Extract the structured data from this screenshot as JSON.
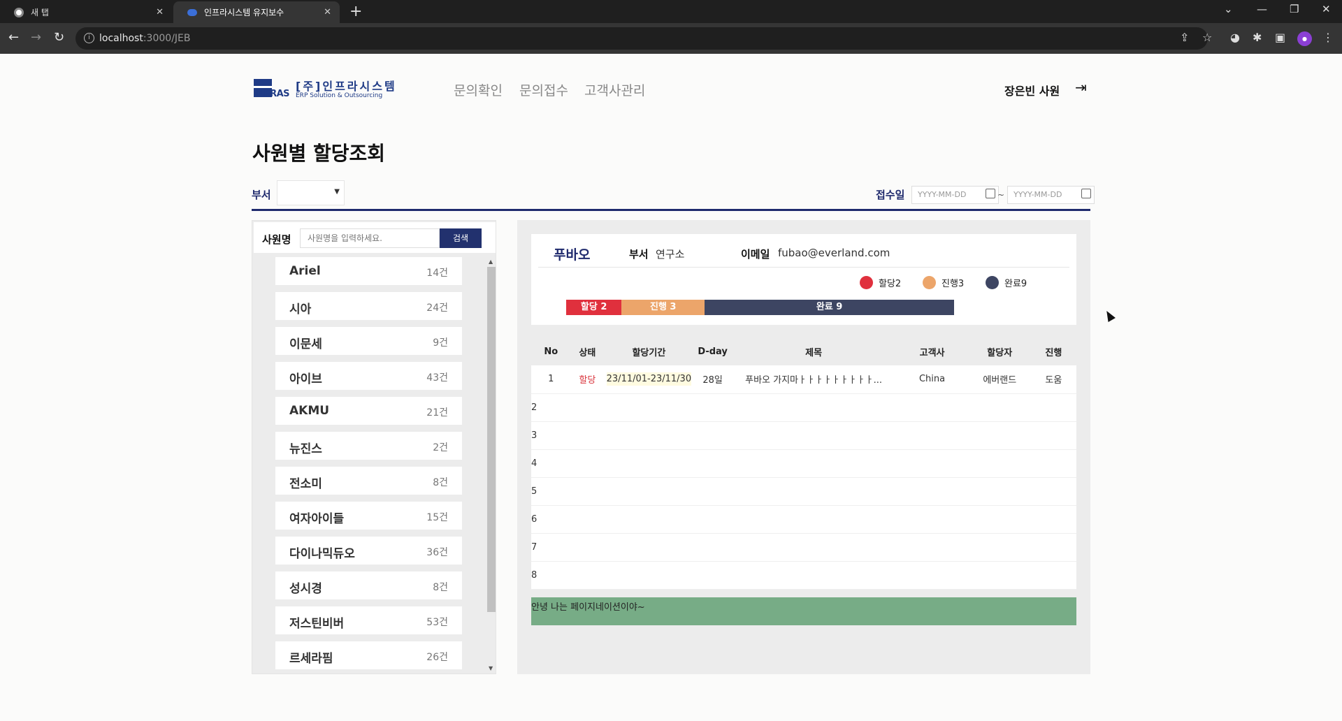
{
  "browser": {
    "tabs": [
      {
        "title": "새 탭",
        "active": false
      },
      {
        "title": "인프라시스템 유지보수",
        "active": true
      }
    ],
    "url_host": "localhost",
    "url_path": ":3000/JEB"
  },
  "header": {
    "logo_brand": "INFRAS",
    "logo_name": "[주]인프라시스템",
    "logo_sub": "ERP Solution & Outsourcing",
    "nav": [
      "문의확인",
      "문의접수",
      "고객사관리"
    ],
    "user": "장은빈 사원"
  },
  "page": {
    "title": "사원별 할당조회"
  },
  "filters": {
    "dept_label": "부서",
    "dept_value": "",
    "date_label": "접수일",
    "date_from_placeholder": "YYYY-MM-DD",
    "date_to_placeholder": "YYYY-MM-DD",
    "separator": "~"
  },
  "employee_search": {
    "label": "사원명",
    "placeholder": "사원명을 입력하세요.",
    "button": "검색"
  },
  "employees": [
    {
      "name": "Ariel",
      "count": "14건"
    },
    {
      "name": "시아",
      "count": "24건"
    },
    {
      "name": "이문세",
      "count": "9건"
    },
    {
      "name": "아이브",
      "count": "43건"
    },
    {
      "name": "AKMU",
      "count": "21건"
    },
    {
      "name": "뉴진스",
      "count": "2건"
    },
    {
      "name": "전소미",
      "count": "8건"
    },
    {
      "name": "여자아이들",
      "count": "15건"
    },
    {
      "name": "다이나믹듀오",
      "count": "36건"
    },
    {
      "name": "성시경",
      "count": "8건"
    },
    {
      "name": "저스틴비버",
      "count": "53건"
    },
    {
      "name": "르세라핌",
      "count": "26건"
    }
  ],
  "detail": {
    "name": "푸바오",
    "dept_label": "부서",
    "dept": "연구소",
    "email_label": "이메일",
    "email": "fubao@everland.com",
    "legend": [
      {
        "label": "할당2",
        "color": "#e0303d"
      },
      {
        "label": "진행3",
        "color": "#eca56a"
      },
      {
        "label": "완료9",
        "color": "#3d4562"
      }
    ],
    "bar": [
      {
        "label": "할당 2",
        "value": 2,
        "color": "#e0303d"
      },
      {
        "label": "진행 3",
        "value": 3,
        "color": "#eca56a"
      },
      {
        "label": "완료 9",
        "value": 9,
        "color": "#3d4562"
      }
    ]
  },
  "table": {
    "headers": [
      "No",
      "상태",
      "할당기간",
      "D-day",
      "제목",
      "고객사",
      "할당자",
      "진행"
    ],
    "rows": [
      {
        "no": "1",
        "status": "할당",
        "period": "23/11/01-23/11/30",
        "dday": "28일",
        "title": "푸바오 가지마ㅏㅏㅏㅏㅏㅏㅏㅏㅏ...",
        "client": "China",
        "assigner": "에버랜드",
        "progress": "도움"
      }
    ],
    "empty_rows": [
      "2",
      "3",
      "4",
      "5",
      "6",
      "7",
      "8"
    ]
  },
  "pagination": {
    "text": "안녕 나는 페이지네이션이야~"
  }
}
